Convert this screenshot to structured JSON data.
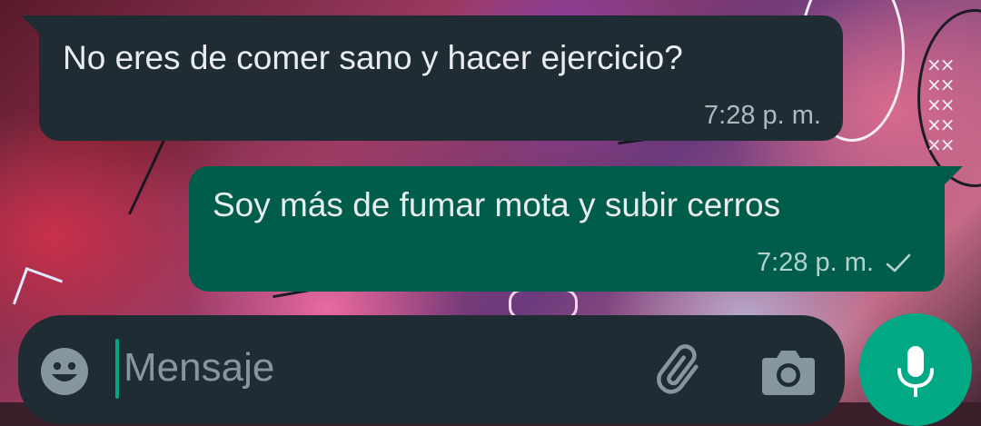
{
  "messages": [
    {
      "direction": "incoming",
      "text": "No eres de comer sano y hacer ejercicio?",
      "time": "7:28 p. m."
    },
    {
      "direction": "outgoing",
      "text": "Soy más de fumar mota y subir cerros",
      "time": "7:28 p. m.",
      "status": "sent-check-icon"
    }
  ],
  "composer": {
    "placeholder": "Mensaje",
    "icons": [
      "emoji-icon",
      "attach-icon",
      "camera-icon",
      "mic-icon"
    ]
  },
  "colors": {
    "incoming_bubble": "#202c33",
    "outgoing_bubble": "#005c4b",
    "accent": "#00a884",
    "text": "#e9edef",
    "meta_text": "#aebac1",
    "placeholder": "#8696a0"
  }
}
